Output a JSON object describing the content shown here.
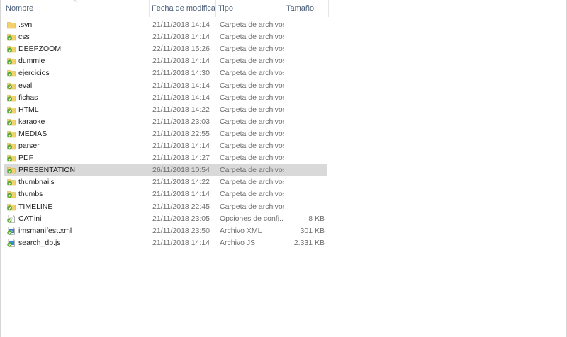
{
  "header": {
    "name": "Nombre",
    "date": "Fecha de modifica...",
    "type": "Tipo",
    "size": "Tamaño"
  },
  "colors": {
    "selected_row": "#d9d9d9",
    "folder_yellow": "#f2d36b",
    "sync_green": "#5aa832",
    "header_text": "#4c607a"
  },
  "rows": [
    {
      "name": ".svn",
      "date": "21/11/2018 14:14",
      "type": "Carpeta de archivos",
      "size": "",
      "icon": "folder-plain-icon"
    },
    {
      "name": "css",
      "date": "21/11/2018 14:14",
      "type": "Carpeta de archivos",
      "size": "",
      "icon": "folder-sync-icon"
    },
    {
      "name": "DEEPZOOM",
      "date": "22/11/2018 15:26",
      "type": "Carpeta de archivos",
      "size": "",
      "icon": "folder-sync-icon"
    },
    {
      "name": "dummie",
      "date": "21/11/2018 14:14",
      "type": "Carpeta de archivos",
      "size": "",
      "icon": "folder-sync-icon"
    },
    {
      "name": "ejercicios",
      "date": "21/11/2018 14:30",
      "type": "Carpeta de archivos",
      "size": "",
      "icon": "folder-sync-icon"
    },
    {
      "name": "eval",
      "date": "21/11/2018 14:14",
      "type": "Carpeta de archivos",
      "size": "",
      "icon": "folder-sync-icon"
    },
    {
      "name": "fichas",
      "date": "21/11/2018 14:14",
      "type": "Carpeta de archivos",
      "size": "",
      "icon": "folder-sync-icon"
    },
    {
      "name": "HTML",
      "date": "21/11/2018 14:22",
      "type": "Carpeta de archivos",
      "size": "",
      "icon": "folder-sync-icon"
    },
    {
      "name": "karaoke",
      "date": "21/11/2018 23:03",
      "type": "Carpeta de archivos",
      "size": "",
      "icon": "folder-sync-icon"
    },
    {
      "name": "MEDIAS",
      "date": "21/11/2018 22:55",
      "type": "Carpeta de archivos",
      "size": "",
      "icon": "folder-sync-icon"
    },
    {
      "name": "parser",
      "date": "21/11/2018 14:14",
      "type": "Carpeta de archivos",
      "size": "",
      "icon": "folder-sync-icon"
    },
    {
      "name": "PDF",
      "date": "21/11/2018 14:27",
      "type": "Carpeta de archivos",
      "size": "",
      "icon": "folder-sync-icon"
    },
    {
      "name": "PRESENTATION",
      "date": "26/11/2018 10:54",
      "type": "Carpeta de archivos",
      "size": "",
      "icon": "folder-sync-icon",
      "selected": true
    },
    {
      "name": "thumbnails",
      "date": "21/11/2018 14:22",
      "type": "Carpeta de archivos",
      "size": "",
      "icon": "folder-sync-icon"
    },
    {
      "name": "thumbs",
      "date": "21/11/2018 14:14",
      "type": "Carpeta de archivos",
      "size": "",
      "icon": "folder-sync-icon"
    },
    {
      "name": "TIMELINE",
      "date": "21/11/2018 22:45",
      "type": "Carpeta de archivos",
      "size": "",
      "icon": "folder-sync-icon"
    },
    {
      "name": "CAT.ini",
      "date": "21/11/2018 23:05",
      "type": "Opciones de confi...",
      "size": "8 KB",
      "icon": "ini-file-sync-icon"
    },
    {
      "name": "imsmanifest.xml",
      "date": "21/11/2018 23:50",
      "type": "Archivo XML",
      "size": "301 KB",
      "icon": "xml-file-sync-icon"
    },
    {
      "name": "search_db.js",
      "date": "21/11/2018 14:14",
      "type": "Archivo JS",
      "size": "2.331 KB",
      "icon": "js-file-sync-icon"
    }
  ]
}
